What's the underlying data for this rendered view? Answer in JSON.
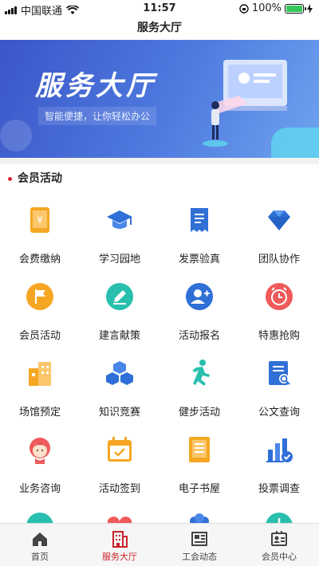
{
  "status_bar": {
    "carrier": "中国联通",
    "time": "11:57",
    "battery": "100%"
  },
  "nav": {
    "title": "服务大厅"
  },
  "banner": {
    "title": "服务大厅",
    "subtitle": "智能便捷，让你轻松办公"
  },
  "section": {
    "title": "会员活动"
  },
  "grid": {
    "items": [
      {
        "label": "会费缴纳",
        "icon": "tablet-yuan-icon",
        "color": "#f5a623"
      },
      {
        "label": "学习园地",
        "icon": "graduation-cap-icon",
        "color": "#2f6fd6"
      },
      {
        "label": "发票验真",
        "icon": "receipt-icon",
        "color": "#2f6fd6"
      },
      {
        "label": "团队协作",
        "icon": "diamond-icon",
        "color": "#2f6fd6"
      },
      {
        "label": "会员活动",
        "icon": "flag-icon",
        "color": "#f5a623"
      },
      {
        "label": "建言献策",
        "icon": "pencil-icon",
        "color": "#29bfae"
      },
      {
        "label": "活动报名",
        "icon": "add-user-icon",
        "color": "#2f6fd6"
      },
      {
        "label": "特惠抢购",
        "icon": "alarm-icon",
        "color": "#f05a5a"
      },
      {
        "label": "场馆预定",
        "icon": "building-icon",
        "color": "#f5a623"
      },
      {
        "label": "知识竞赛",
        "icon": "cubes-icon",
        "color": "#2f6fd6"
      },
      {
        "label": "健步活动",
        "icon": "runner-icon",
        "color": "#29bfae"
      },
      {
        "label": "公文查询",
        "icon": "document-search-icon",
        "color": "#2f6fd6"
      },
      {
        "label": "业务咨询",
        "icon": "support-agent-icon",
        "color": "#f05a5a"
      },
      {
        "label": "活动签到",
        "icon": "calendar-check-icon",
        "color": "#f5a623"
      },
      {
        "label": "电子书屋",
        "icon": "book-icon",
        "color": "#f5a623"
      },
      {
        "label": "投票调查",
        "icon": "bar-chart-check-icon",
        "color": "#2f6fd6"
      }
    ]
  },
  "tab_bar": {
    "tabs": [
      {
        "label": "首页",
        "icon": "home-icon"
      },
      {
        "label": "服务大厅",
        "icon": "building-grid-icon",
        "active": true
      },
      {
        "label": "工会动态",
        "icon": "newspaper-icon"
      },
      {
        "label": "会员中心",
        "icon": "id-card-icon"
      }
    ]
  },
  "colors": {
    "accent": "#c8222a",
    "banner_start": "#3a56c8",
    "banner_end": "#6fa3ee"
  }
}
